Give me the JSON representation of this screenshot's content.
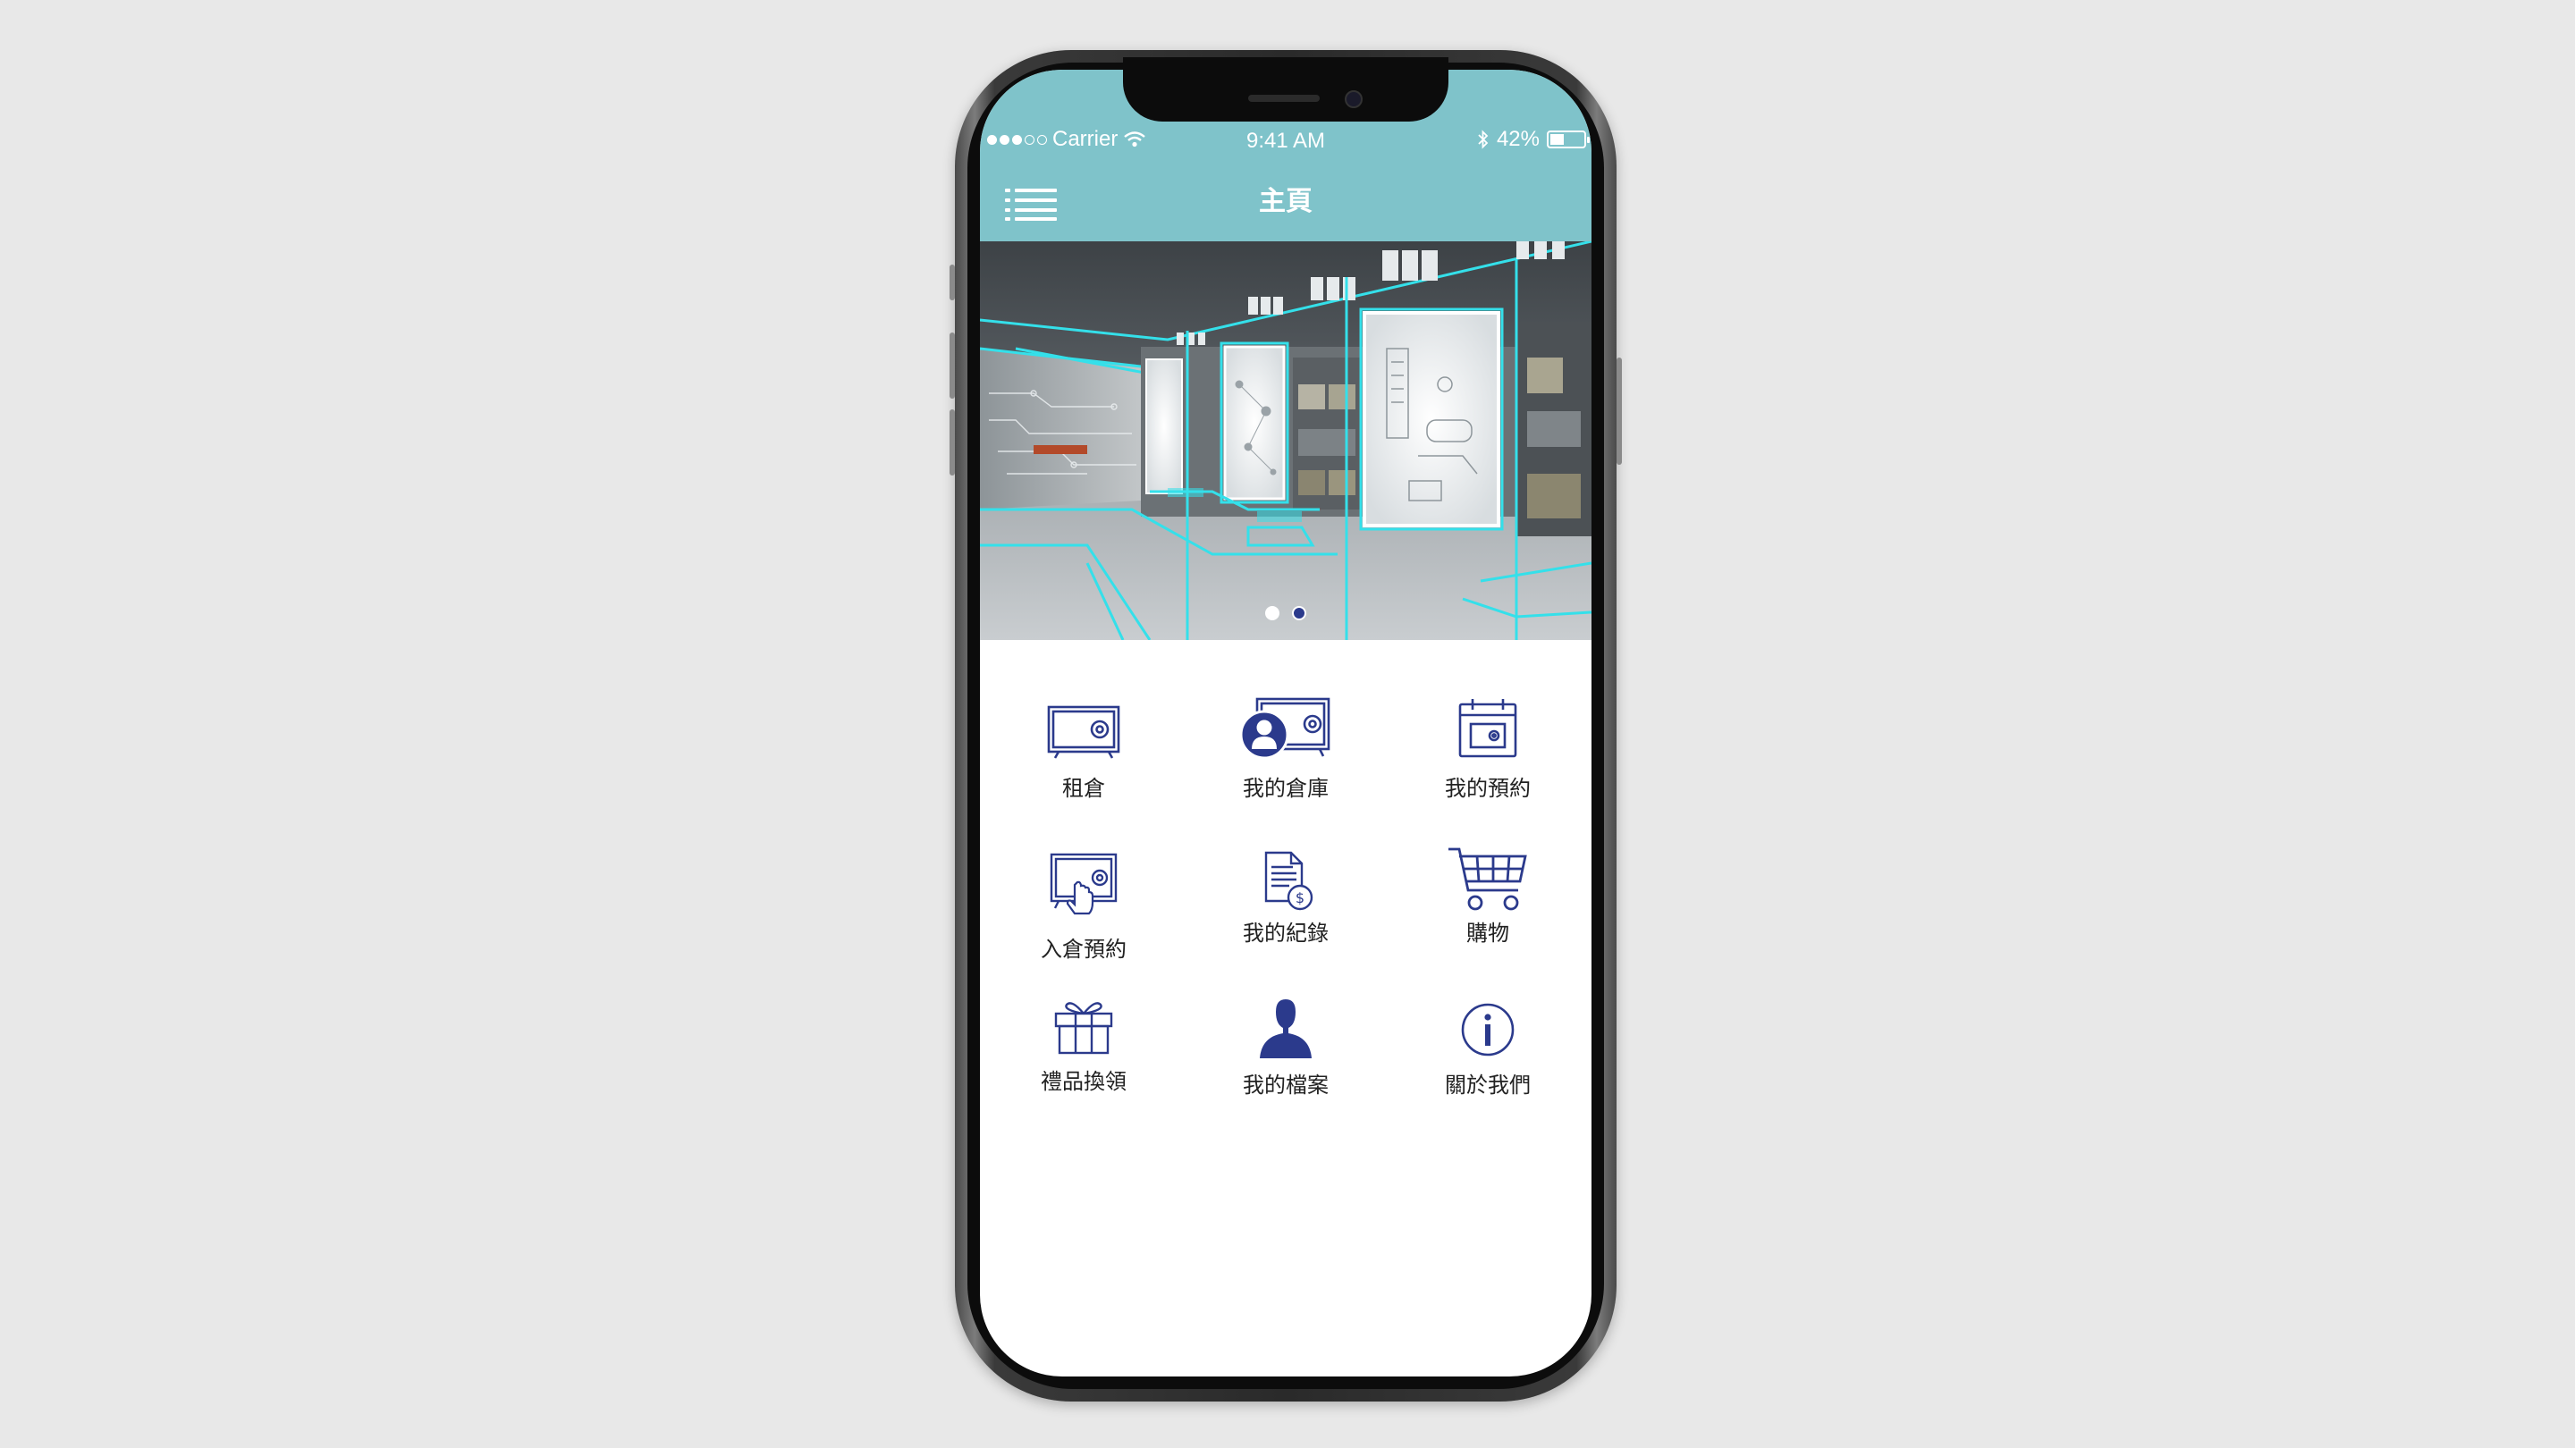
{
  "status_bar": {
    "carrier": "Carrier",
    "time": "9:41 AM",
    "battery": "42%",
    "battery_level": 0.42
  },
  "header": {
    "title": "主頁",
    "menu_icon": "hamburger-menu-icon",
    "bg_color": "#7fc3ca"
  },
  "banner": {
    "slide_count": 2,
    "active_slide": 2
  },
  "menu": [
    {
      "label": "租倉",
      "icon": "storage-safe-icon"
    },
    {
      "label": "我的倉庫",
      "icon": "my-warehouse-icon"
    },
    {
      "label": "我的預約",
      "icon": "calendar-safe-icon"
    },
    {
      "label": "入倉預約",
      "icon": "safe-tap-icon"
    },
    {
      "label": "我的紀錄",
      "icon": "document-dollar-icon"
    },
    {
      "label": "購物",
      "icon": "shopping-cart-icon"
    },
    {
      "label": "禮品換領",
      "icon": "gift-icon"
    },
    {
      "label": "我的檔案",
      "icon": "user-profile-icon"
    },
    {
      "label": "關於我們",
      "icon": "info-icon"
    }
  ],
  "accent_color": "#2b3a8c"
}
